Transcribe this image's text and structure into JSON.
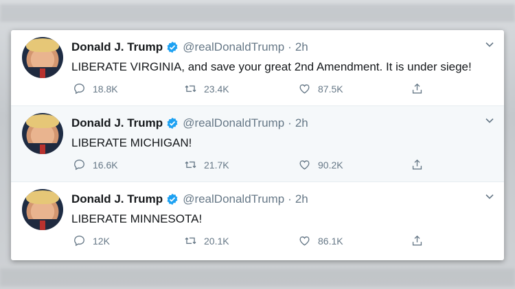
{
  "tweets": [
    {
      "name": "Donald J. Trump",
      "handle": "@realDonaldTrump",
      "time": "2h",
      "text": "LIBERATE VIRGINIA, and save your great 2nd Amendment. It is under siege!",
      "replies": "18.8K",
      "retweets": "23.4K",
      "likes": "87.5K"
    },
    {
      "name": "Donald J. Trump",
      "handle": "@realDonaldTrump",
      "time": "2h",
      "text": "LIBERATE MICHIGAN!",
      "replies": "16.6K",
      "retweets": "21.7K",
      "likes": "90.2K"
    },
    {
      "name": "Donald J. Trump",
      "handle": "@realDonaldTrump",
      "time": "2h",
      "text": "LIBERATE MINNESOTA!",
      "replies": "12K",
      "retweets": "20.1K",
      "likes": "86.1K"
    }
  ],
  "colors": {
    "verified_blue": "#1da1f2",
    "text_primary": "#14171a",
    "text_secondary": "#657786",
    "alt_row_bg": "#f5f8fa"
  },
  "icons": {
    "reply": "reply-icon",
    "retweet": "retweet-icon",
    "like": "heart-icon",
    "share": "share-icon",
    "verified": "verified-badge-icon",
    "menu": "chevron-down-icon"
  }
}
